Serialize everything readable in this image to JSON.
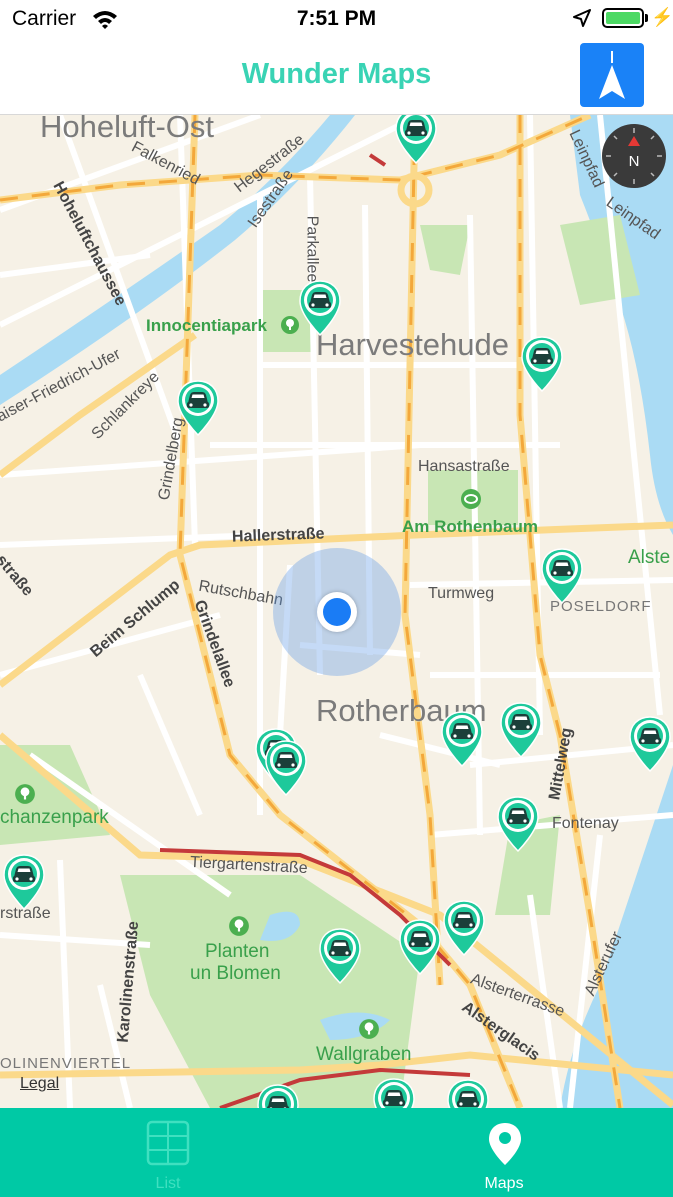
{
  "status_bar": {
    "carrier": "Carrier",
    "time": "7:51 PM"
  },
  "header": {
    "title": "Wunder Maps",
    "locate_icon": "navigation-arrow-icon"
  },
  "map": {
    "districts": [
      "Hoheluft-Ost",
      "Harvestehude",
      "Rotherbaum"
    ],
    "parks": [
      "Innocentiapark",
      "Am Rothenbaum",
      "Planten",
      "un Blomen",
      "Wallgraben",
      "chanzenpark",
      "Alste"
    ],
    "streets": [
      "Hegestraße",
      "Falkenried",
      "Isestraße",
      "Hoheluftchaussee",
      "Parkallee",
      "Leinpfad",
      "Leinpfad",
      "aiser-Friedrich-Ufer",
      "Schlankreye",
      "Grindelberg",
      "Hansastraße",
      "Hallerstraße",
      "Rutschbahn",
      "Turmweg",
      "Beim Schlump",
      "Grindelallee",
      "straße",
      "Mittelweg",
      "Fontenay",
      "Tiergartenstraße",
      "Karolinenstraße",
      "Alsterterrasse",
      "Alsterglacis",
      "Alsterufer",
      "rstraße"
    ],
    "areas": [
      "POSELDORF",
      "OLINENVIERTEL"
    ],
    "legal": "Legal",
    "compass_letter": "N"
  },
  "tabs": [
    {
      "label": "List",
      "icon": "list-grid-icon",
      "selected": false
    },
    {
      "label": "Maps",
      "icon": "map-pin-icon",
      "selected": true
    }
  ],
  "colors": {
    "accent": "#00c9a5",
    "title": "#39d3b4",
    "pin": "#1ec99b",
    "locate_button": "#1a82f7",
    "user_location": "#1a7cf5"
  }
}
